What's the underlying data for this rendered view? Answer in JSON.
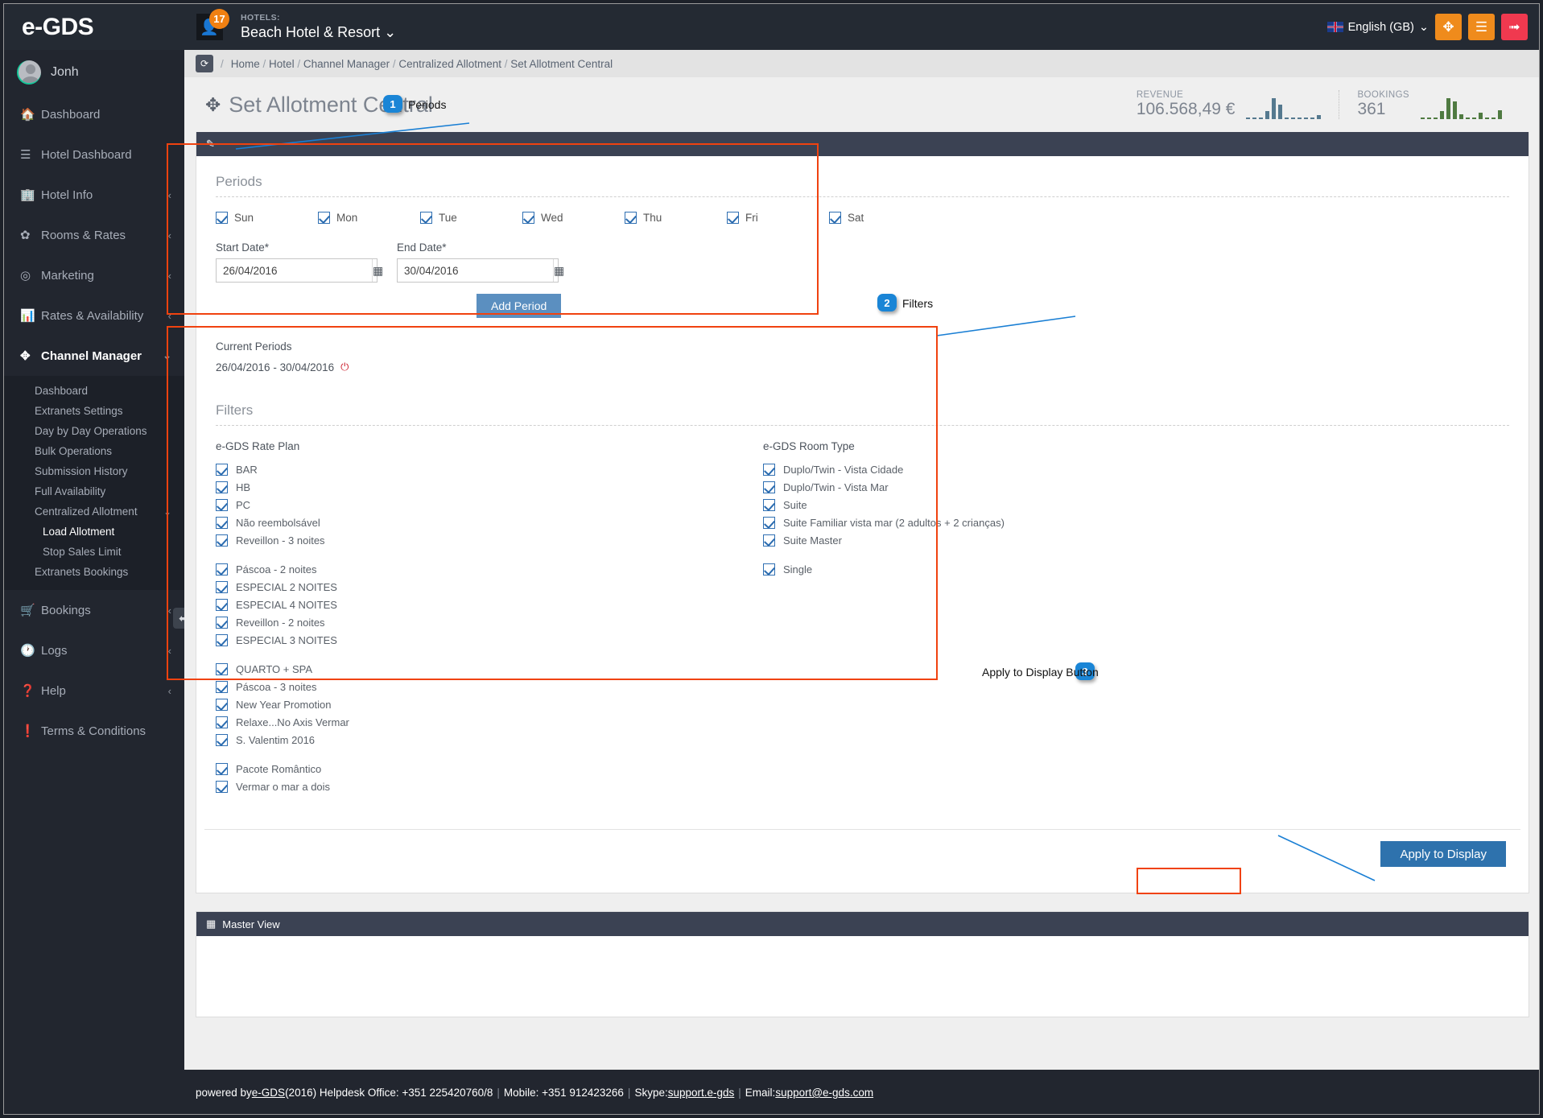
{
  "topbar": {
    "brand": "e-GDS",
    "notification_count": "17",
    "hotels_label": "HOTELS:",
    "hotel_name": "Beach Hotel & Resort",
    "hotel_caret": "⌄",
    "language": "English (GB)",
    "language_caret": "⌄",
    "buttons": [
      {
        "name": "fullscreen-button",
        "glyph": "✥"
      },
      {
        "name": "menu-button",
        "glyph": "☰"
      },
      {
        "name": "logout-button",
        "glyph": "➟"
      }
    ]
  },
  "sidebar": {
    "user": "Jonh",
    "items": [
      {
        "label": "Dashboard",
        "icon": "🏠",
        "caret": "",
        "active": false
      },
      {
        "label": "Hotel Dashboard",
        "icon": "☰",
        "caret": "",
        "active": false
      },
      {
        "label": "Hotel Info",
        "icon": "🏢",
        "caret": "‹",
        "active": false
      },
      {
        "label": "Rooms & Rates",
        "icon": "✿",
        "caret": "‹",
        "active": false
      },
      {
        "label": "Marketing",
        "icon": "◎",
        "caret": "‹",
        "active": false
      },
      {
        "label": "Rates & Availability",
        "icon": "📊",
        "caret": "‹",
        "active": false
      },
      {
        "label": "Channel Manager",
        "icon": "✥",
        "caret": "⌄",
        "active": true
      }
    ],
    "submenu": [
      {
        "label": "Dashboard",
        "caret": "",
        "level": 1,
        "selected": false
      },
      {
        "label": "Extranets Settings",
        "caret": "",
        "level": 1,
        "selected": false
      },
      {
        "label": "Day by Day Operations",
        "caret": "",
        "level": 1,
        "selected": false
      },
      {
        "label": "Bulk Operations",
        "caret": "",
        "level": 1,
        "selected": false
      },
      {
        "label": "Submission History",
        "caret": "",
        "level": 1,
        "selected": false
      },
      {
        "label": "Full Availability",
        "caret": "",
        "level": 1,
        "selected": false
      },
      {
        "label": "Centralized Allotment",
        "caret": "⌄",
        "level": 1,
        "selected": false
      },
      {
        "label": "Load Allotment",
        "caret": "",
        "level": 2,
        "selected": true
      },
      {
        "label": "Stop Sales Limit",
        "caret": "",
        "level": 2,
        "selected": false
      },
      {
        "label": "Extranets Bookings",
        "caret": "",
        "level": 1,
        "selected": false
      }
    ],
    "items_bottom": [
      {
        "label": "Bookings",
        "icon": "🛒",
        "caret": "‹"
      },
      {
        "label": "Logs",
        "icon": "🕐",
        "caret": "‹"
      },
      {
        "label": "Help",
        "icon": "❓",
        "caret": "‹"
      },
      {
        "label": "Terms & Conditions",
        "icon": "❗",
        "caret": ""
      }
    ],
    "collapse_glyph": "⬅"
  },
  "breadcrumb": {
    "refresh_glyph": "⟳",
    "items": [
      "Home",
      "Hotel",
      "Channel Manager",
      "Centralized Allotment",
      "Set Allotment Central"
    ]
  },
  "page": {
    "title": "Set Allotment Central",
    "title_icon": "✥",
    "stats": [
      {
        "label": "REVENUE",
        "value": "106.568,49 €",
        "spark": [
          2,
          2,
          2,
          10,
          26,
          18,
          2,
          2,
          2,
          2,
          2,
          5
        ]
      },
      {
        "label": "BOOKINGS",
        "value": "361",
        "spark": [
          2,
          2,
          2,
          10,
          26,
          22,
          6,
          2,
          2,
          8,
          2,
          2,
          11
        ]
      }
    ]
  },
  "panel": {
    "header_icon": "✎"
  },
  "periods": {
    "legend": "Periods",
    "days": [
      {
        "label": "Sun",
        "checked": true
      },
      {
        "label": "Mon",
        "checked": true
      },
      {
        "label": "Tue",
        "checked": true
      },
      {
        "label": "Wed",
        "checked": true
      },
      {
        "label": "Thu",
        "checked": true
      },
      {
        "label": "Fri",
        "checked": true
      },
      {
        "label": "Sat",
        "checked": true
      }
    ],
    "start_label": "Start Date*",
    "start_value": "26/04/2016",
    "end_label": "End Date*",
    "end_value": "30/04/2016",
    "calendar_glyph": "▦",
    "add_period_label": "Add Period",
    "current_title": "Current Periods",
    "current_value": "26/04/2016 - 30/04/2016",
    "power_glyph": "⏻"
  },
  "filters": {
    "legend": "Filters",
    "rate_plan_head": "e-GDS Rate Plan",
    "room_type_head": "e-GDS Room Type",
    "rate_plan_groups": [
      [
        "BAR",
        "HB",
        "PC",
        "Não reembolsável",
        "Reveillon - 3 noites"
      ],
      [
        "Páscoa - 2 noites",
        "ESPECIAL 2 NOITES",
        "ESPECIAL 4 NOITES",
        "Reveillon - 2 noites",
        "ESPECIAL 3 NOITES"
      ],
      [
        "QUARTO + SPA",
        "Páscoa - 3 noites",
        "New Year Promotion",
        "Relaxe...No Axis Vermar",
        "S. Valentim 2016"
      ],
      [
        "Pacote Romântico",
        "Vermar o mar a dois"
      ]
    ],
    "room_type_groups": [
      [
        "Duplo/Twin - Vista Cidade",
        "Duplo/Twin - Vista Mar",
        "Suite",
        "Suite Familiar vista mar (2 adultos + 2 crianças)",
        "Suite Master"
      ],
      [
        "Single"
      ]
    ]
  },
  "apply": {
    "label": "Apply to Display"
  },
  "master_view": {
    "icon": "▦",
    "title": "Master View"
  },
  "footer": {
    "prefix": "powered by ",
    "brand": "e-GDS",
    "text1": " (2016) Helpdesk Office: +351 225420760/8 ",
    "sep": "|",
    "text2": " Mobile: +351 912423266 ",
    "text3": " Skype: ",
    "skype": "support.e-gds",
    "text4": " Email: ",
    "email": "support@e-gds.com"
  },
  "annotations": [
    {
      "number": "1",
      "label": "Periods"
    },
    {
      "number": "2",
      "label": "Filters"
    },
    {
      "number": "3",
      "label": "Apply to Display Button"
    }
  ]
}
